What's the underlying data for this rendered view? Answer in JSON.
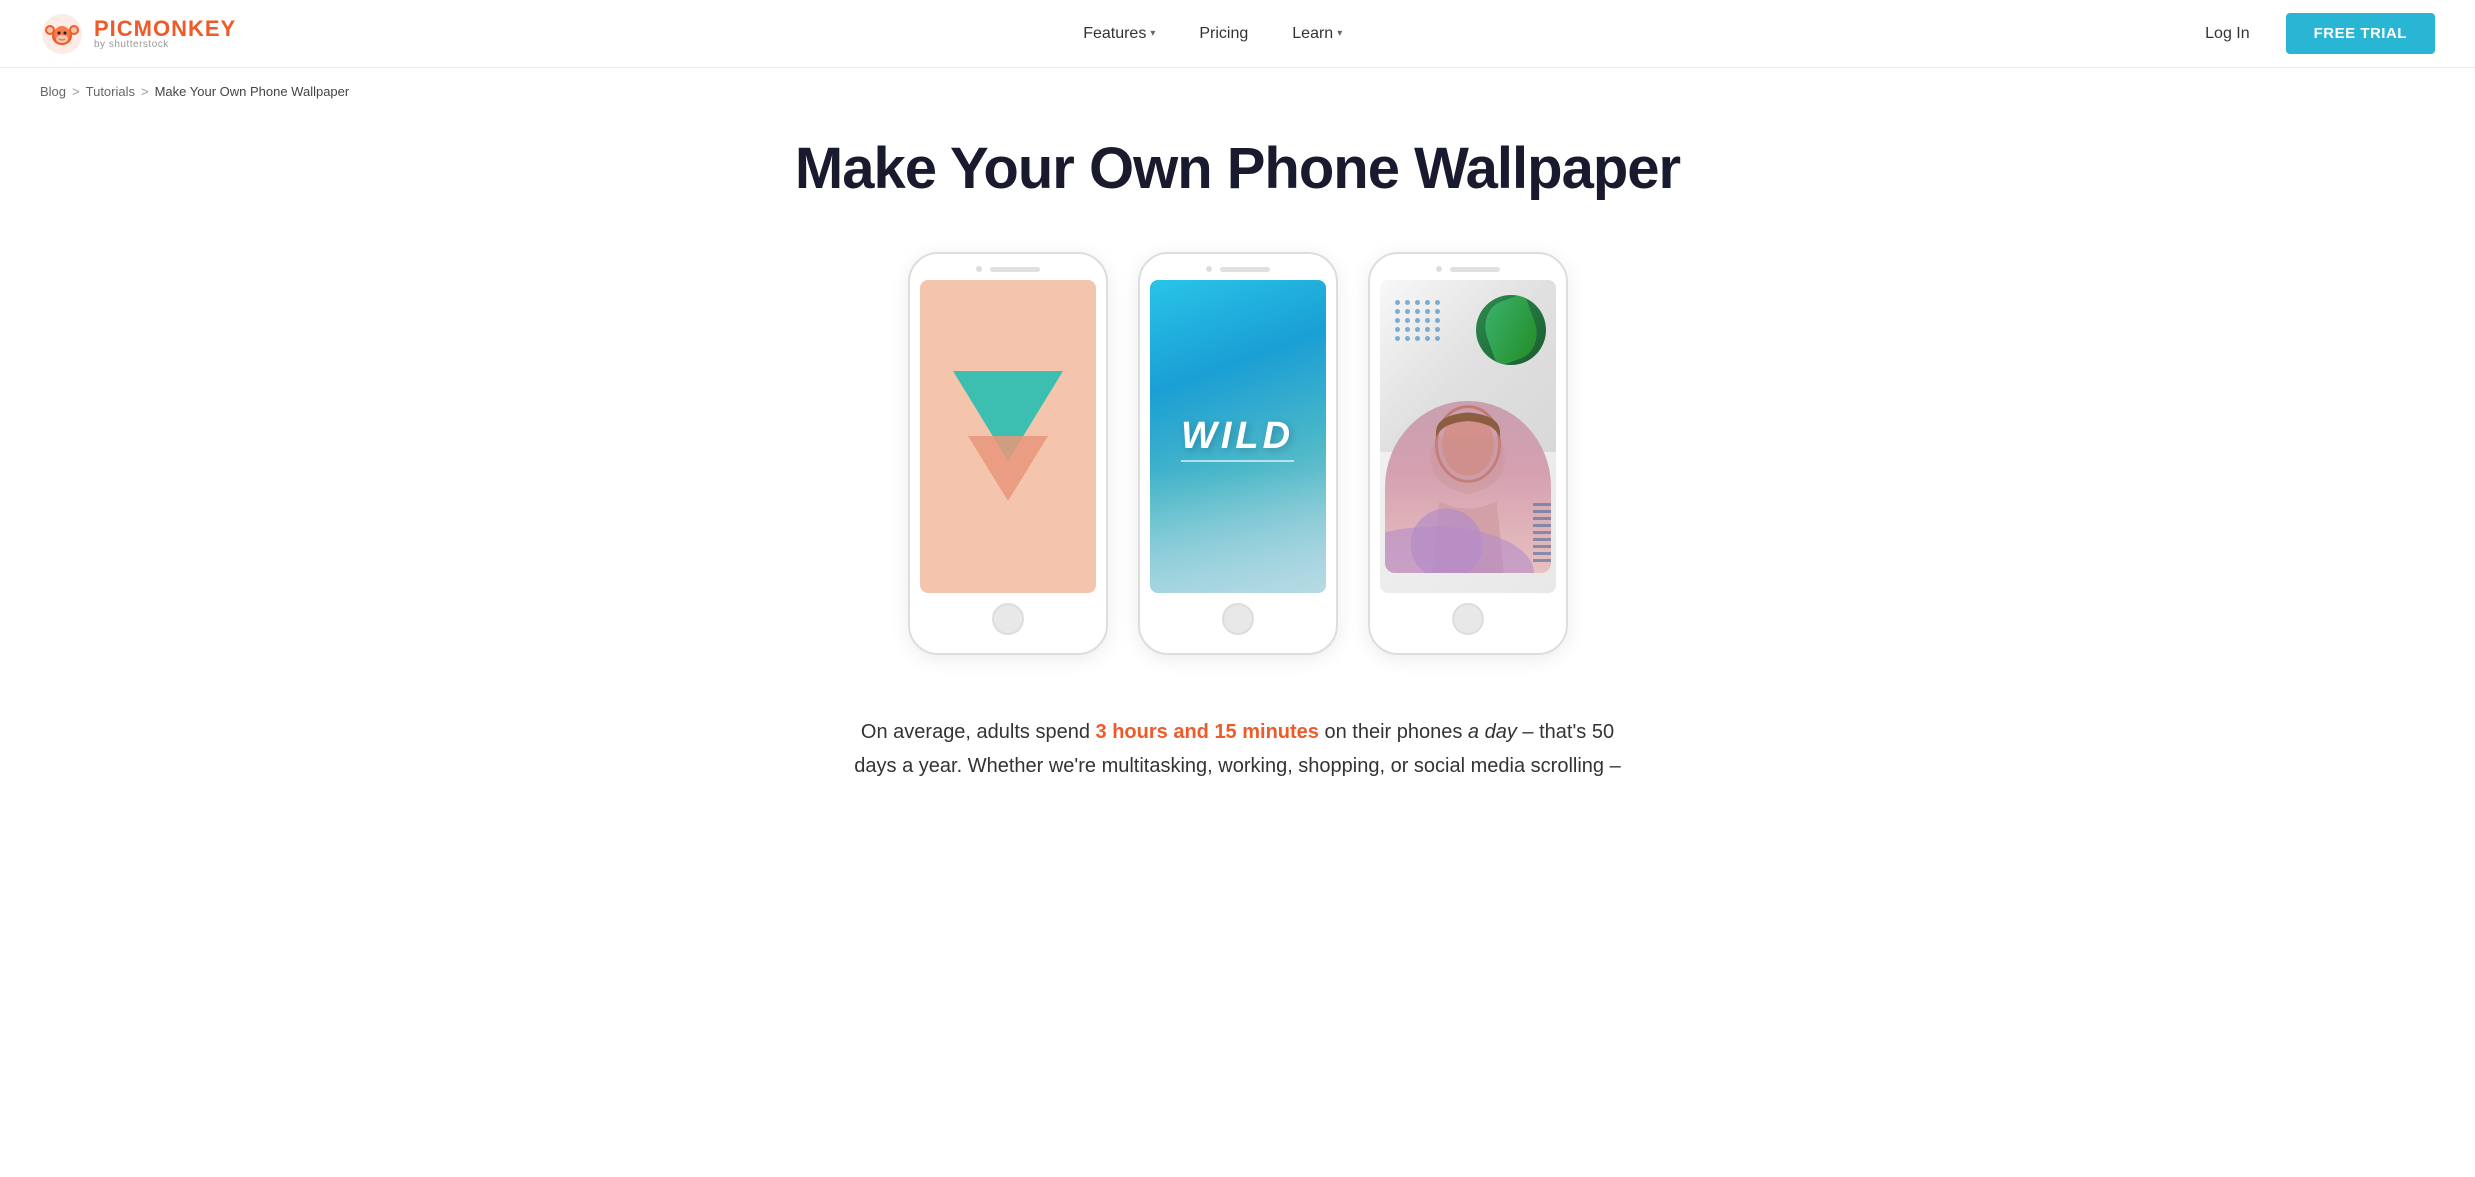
{
  "header": {
    "logo_main": "PICMONKEY",
    "logo_sub": "by shutterstock",
    "nav": [
      {
        "id": "features",
        "label": "Features",
        "has_dropdown": true
      },
      {
        "id": "pricing",
        "label": "Pricing",
        "has_dropdown": false
      },
      {
        "id": "learn",
        "label": "Learn",
        "has_dropdown": true
      }
    ],
    "login_label": "Log In",
    "trial_label": "FREE TRIAL"
  },
  "breadcrumb": {
    "items": [
      {
        "label": "Blog",
        "link": true
      },
      {
        "label": "Tutorials",
        "link": true
      },
      {
        "label": "Make Your Own Phone Wallpaper",
        "link": false
      }
    ],
    "separator": ">"
  },
  "main": {
    "page_title": "Make Your Own Phone Wallpaper",
    "phones": [
      {
        "id": "phone1",
        "theme": "peach-triangle"
      },
      {
        "id": "phone2",
        "theme": "ocean-wild"
      },
      {
        "id": "phone3",
        "theme": "marble-collage"
      }
    ],
    "wild_text": "WILD",
    "body_text_before": "On average, adults spend ",
    "body_highlight": "3 hours and 15 minutes",
    "body_text_middle": " on their phones ",
    "body_italic": "a day",
    "body_text_after": " – that's 50 days a year. Whether we're multitasking, working, shopping, or social media scrolling –"
  },
  "colors": {
    "orange": "#f05a28",
    "teal_btn": "#29b6d4",
    "logo_orange": "#f05a28"
  }
}
